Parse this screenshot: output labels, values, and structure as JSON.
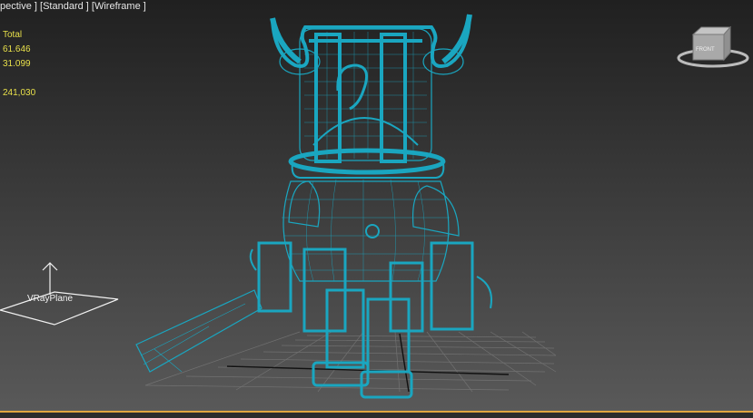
{
  "viewport": {
    "label_view": "pective ]",
    "label_shading": "[Standard ]",
    "label_mode": "[Wireframe ]"
  },
  "stats": {
    "title": "Total",
    "polys": "61.646",
    "verts": "31.099",
    "fps": "241,030"
  },
  "scene": {
    "plane_label": "VRayPlane",
    "viewcube_label": "FRONT"
  },
  "colors": {
    "wire": "#1aa6c0",
    "stats_text": "#e8e04a",
    "grid": "#8a8a8a",
    "accent": "#e2a640"
  }
}
